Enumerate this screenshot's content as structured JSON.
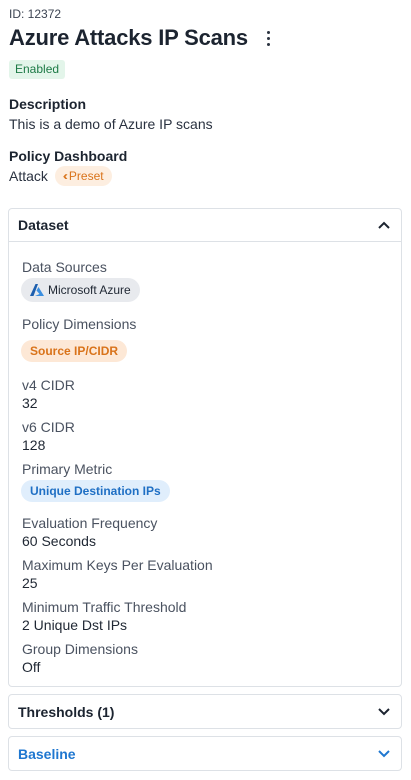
{
  "header": {
    "id_text": "ID: 12372",
    "title": "Azure Attacks IP Scans",
    "status_badge": "Enabled"
  },
  "description": {
    "label": "Description",
    "value": "This is a demo of Azure IP scans"
  },
  "policy_dashboard": {
    "label": "Policy Dashboard",
    "value": "Attack",
    "preset_badge": "Preset"
  },
  "dataset": {
    "title": "Dataset",
    "data_sources_label": "Data Sources",
    "data_source": "Microsoft Azure",
    "policy_dimensions_label": "Policy Dimensions",
    "policy_dimension": "Source IP/CIDR",
    "v4_cidr_label": "v4 CIDR",
    "v4_cidr_value": "32",
    "v6_cidr_label": "v6 CIDR",
    "v6_cidr_value": "128",
    "primary_metric_label": "Primary Metric",
    "primary_metric": "Unique Destination IPs",
    "eval_freq_label": "Evaluation Frequency",
    "eval_freq_value": "60 Seconds",
    "max_keys_label": "Maximum Keys Per Evaluation",
    "max_keys_value": "25",
    "min_traffic_label": "Minimum Traffic Threshold",
    "min_traffic_value": "2 Unique Dst IPs",
    "group_dims_label": "Group Dimensions",
    "group_dims_value": "Off"
  },
  "thresholds": {
    "title": "Thresholds (1)"
  },
  "baseline": {
    "title": "Baseline"
  },
  "colors": {
    "enabled_bg": "#e3f5ea",
    "enabled_text": "#1d7a46",
    "preset_bg": "#fdeee0",
    "preset_text": "#d9731a",
    "metric_bg": "#e0eefc",
    "metric_text": "#1f6fc4",
    "baseline_text": "#1f77d0"
  },
  "icons": {
    "kebab": "more-vertical-icon",
    "preset": "double-chevron-left-icon",
    "azure": "azure-logo-icon",
    "expand": "chevron-up-icon",
    "collapse": "chevron-down-icon"
  }
}
